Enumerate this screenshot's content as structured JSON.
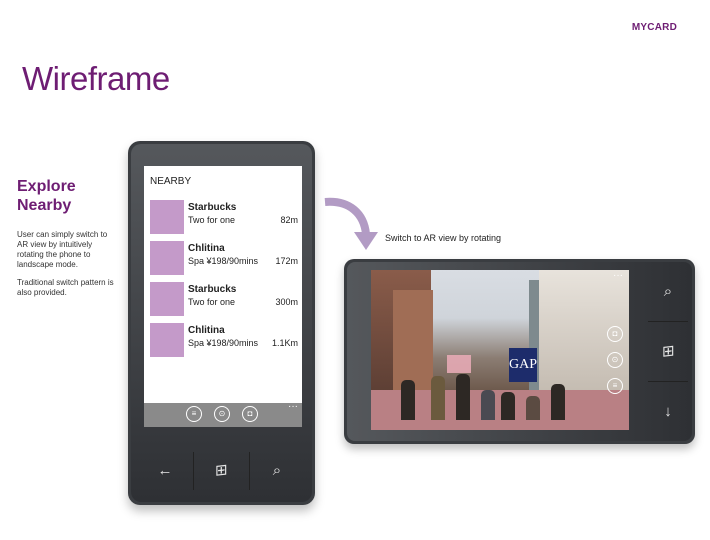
{
  "brand": "MYCARD",
  "title": "Wireframe",
  "explore": {
    "heading_line1": "Explore",
    "heading_line2": "Nearby",
    "paragraph1": "User can simply switch to AR view by intuitively rotating the phone to landscape mode.",
    "paragraph2": "Traditional switch pattern is also provided."
  },
  "phone": {
    "list_title": "NEARBY",
    "items": [
      {
        "name": "Starbucks",
        "desc": "Two for one",
        "distance": "82m"
      },
      {
        "name": "Chlitina",
        "desc": "Spa ¥198/90mins",
        "distance": "172m"
      },
      {
        "name": "Starbucks",
        "desc": "Two for one",
        "distance": "300m"
      },
      {
        "name": "Chlitina",
        "desc": "Spa ¥198/90mins",
        "distance": "1.1Km"
      }
    ],
    "appbar": {
      "list_icon": "≡",
      "location_icon": "⊙",
      "camera_icon": "◘",
      "more": "···"
    },
    "hardware": {
      "back": "←",
      "windows": "⊞",
      "search": "⌕"
    }
  },
  "caption": "Switch to AR view by rotating",
  "ar": {
    "sign_text": "GAP",
    "more": "···",
    "icons": {
      "camera": "◘",
      "location": "⊙",
      "list": "≡"
    },
    "hardware": {
      "search": "⌕",
      "windows": "⊞",
      "back": "↓"
    }
  },
  "colors": {
    "accent": "#6e1d73",
    "thumb": "#c49ac9",
    "appbar": "#8a8a8a",
    "phone_body": "#3a3d41"
  }
}
